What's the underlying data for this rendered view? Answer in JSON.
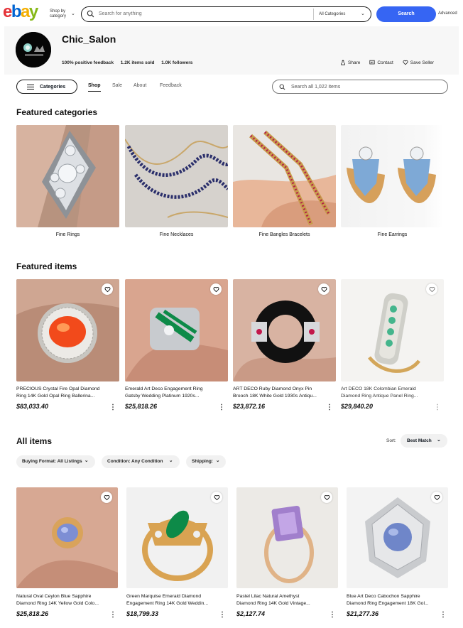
{
  "header": {
    "logo": [
      "e",
      "b",
      "a",
      "y"
    ],
    "shop_by_line1": "Shop by",
    "shop_by_line2": "category",
    "search_placeholder": "Search for anything",
    "category_select": "All Categories",
    "search_button": "Search",
    "advanced": "Advanced"
  },
  "seller": {
    "name": "Chic_Salon",
    "feedback": "100% positive feedback",
    "sold": "1.2K items sold",
    "followers": "1.0K followers",
    "share": "Share",
    "contact": "Contact",
    "save": "Save Seller"
  },
  "store_nav": {
    "categories_button": "Categories",
    "tabs": [
      "Shop",
      "Sale",
      "About",
      "Feedback"
    ],
    "active_tab": "Shop",
    "search_placeholder": "Search all 1,022 items"
  },
  "featured_categories": {
    "title": "Featured categories",
    "items": [
      {
        "label": "Fine Rings"
      },
      {
        "label": "Fine Necklaces"
      },
      {
        "label": "Fine Bangles Bracelets"
      },
      {
        "label": "Fine Earrings"
      }
    ]
  },
  "featured_items": {
    "title": "Featured items",
    "items": [
      {
        "title_line1": "PRECIOUS Crystal Fire Opal Diamond",
        "title_line2": "Ring 14K Gold Opal Ring Ballerina...",
        "price": "$83,033.40"
      },
      {
        "title_line1": "Emerald Art Deco Engagement Ring",
        "title_line2": "Gatsby Wedding Platinum 1920s...",
        "price": "$25,818.26"
      },
      {
        "title_line1": "ART DECO Ruby Diamond Onyx Pin",
        "title_line2": "Brooch 18K White Gold 1930s Antiqu...",
        "price": "$23,872.16"
      },
      {
        "title_line1": "Art DECO 18K Colombian Emerald",
        "title_line2": "Diamond Ring Antique Panel Ring...",
        "price": "$29,840.20"
      }
    ]
  },
  "all_items": {
    "title": "All items",
    "sort_label": "Sort:",
    "sort_value": "Best Match",
    "filters": [
      "Buying Format: All Listings",
      "Condition: Any Condition",
      "Shipping:"
    ],
    "items": [
      {
        "title_line1": "Natural Oval Ceylon Blue Sapphire",
        "title_line2": "Diamond Ring 14K Yellow Gold Colo...",
        "price": "$25,818.26"
      },
      {
        "title_line1": "Green Marquise Emerald Diamond",
        "title_line2": "Engagement Ring 14K Gold Weddin...",
        "price": "$18,799.33"
      },
      {
        "title_line1": "Pastel Lilac Natural Amethyst",
        "title_line2": "Diamond Ring 14K Gold Vintage...",
        "price": "$2,127.74"
      },
      {
        "title_line1": "Blue Art Deco Cabochon Sapphire",
        "title_line2": "Diamond Ring Engagement 18K Gol...",
        "price": "$21,277.36"
      }
    ]
  },
  "colors": {
    "accent": "#3665f3",
    "text": "#111820",
    "seller_band": "#f7f7f7"
  }
}
